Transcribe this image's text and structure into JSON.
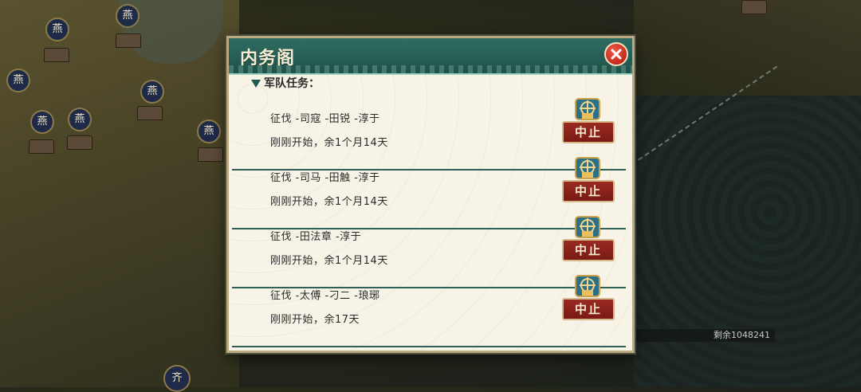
{
  "dialog": {
    "title": "内务阁",
    "section_header": "军队任务：",
    "tasks": [
      {
        "title": "征伐 -司寇 -田锐 -淳于",
        "status": "刚刚开始，余1个月14天",
        "badge": "远征",
        "button": "中止"
      },
      {
        "title": "征伐 -司马 -田触 -淳于",
        "status": "刚刚开始，余1个月14天",
        "badge": "远征",
        "button": "中止"
      },
      {
        "title": "征伐 -田法章 -淳于",
        "status": "刚刚开始，余1个月14天",
        "badge": "远征",
        "button": "中止"
      },
      {
        "title": "征伐 -太傅 -刁二 -琅琊",
        "status": "刚刚开始，余17天",
        "badge": "远征",
        "button": "中止"
      }
    ]
  },
  "map": {
    "markers": [
      "燕",
      "燕",
      "燕",
      "燕",
      "燕",
      "燕",
      "燕"
    ],
    "bottom_marker": "齐",
    "remaining_label": "剩余1048241"
  },
  "colors": {
    "header_teal": "#2f6c62",
    "abort_red": "#8a2019",
    "panel_bg": "#f5f1e4",
    "divider": "#2f5f57"
  },
  "icons": {
    "close": "close-icon",
    "expedition": "expedition-badge-icon",
    "section": "triangle-down-icon"
  }
}
